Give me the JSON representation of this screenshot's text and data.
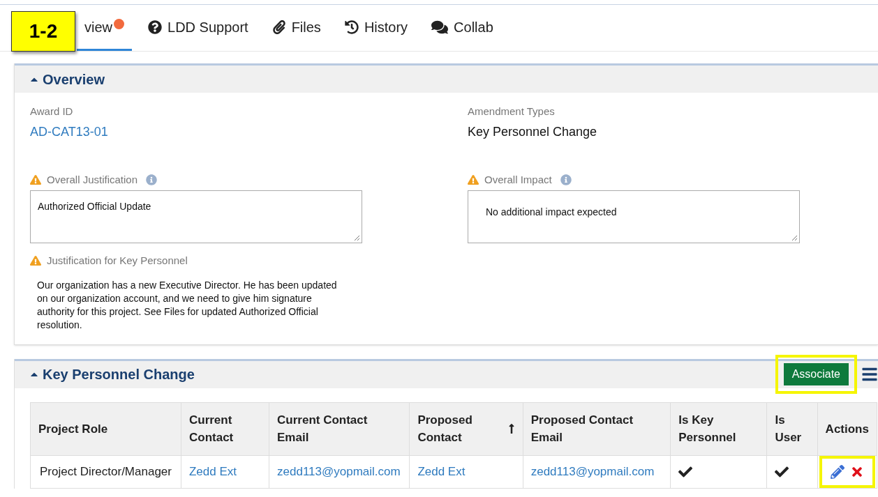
{
  "callout": {
    "label": "1-2"
  },
  "tabs": [
    {
      "label": "view",
      "kind": "plain",
      "selected": true,
      "alert": true
    },
    {
      "label": "LDD Support",
      "kind": "help",
      "selected": false,
      "alert": false
    },
    {
      "label": "Files",
      "kind": "attachments",
      "selected": false,
      "alert": false
    },
    {
      "label": "History",
      "kind": "history",
      "selected": false,
      "alert": false
    },
    {
      "label": "Collab",
      "kind": "chat",
      "selected": false,
      "alert": false
    }
  ],
  "overview": {
    "title": "Overview",
    "expanded": true,
    "award_id": {
      "label": "Award ID",
      "value": "AD-CAT13-01"
    },
    "amendment_types": {
      "label": "Amendment Types",
      "value": "Key Personnel Change"
    },
    "overall_justification": {
      "label": "Overall Justification",
      "value": "Authorized Official Update"
    },
    "overall_impact": {
      "label": "Overall Impact",
      "value": "No additional impact expected"
    },
    "key_personnel_justification": {
      "label": "Justification for Key Personnel",
      "value": "Our organization has a new Executive Director. He has been updated on our organization account, and we need to give him signature authority for this project. See Files for updated Authorized Official resolution."
    }
  },
  "key_personnel": {
    "title": "Key Personnel Change",
    "expanded": true,
    "associate_button": {
      "label": "Associate",
      "highlighted": true
    },
    "table": {
      "columns": [
        {
          "label": "Project Role",
          "sorted": false
        },
        {
          "label": "Current Contact",
          "sorted": false
        },
        {
          "label": "Current Contact Email",
          "sorted": false
        },
        {
          "label": "Proposed Contact",
          "sorted": true
        },
        {
          "label": "Proposed Contact Email",
          "sorted": false
        },
        {
          "label": "Is Key Personnel",
          "sorted": false
        },
        {
          "label": "Is User",
          "sorted": false
        },
        {
          "label": "Actions",
          "sorted": false
        }
      ],
      "rows": [
        {
          "project_role": "Project Director/Manager",
          "current_contact": "Zedd Ext",
          "current_email": "zedd113@yopmail.com",
          "proposed_contact": "Zedd Ext",
          "proposed_email": "zedd113@yopmail.com",
          "is_key_personnel": true,
          "is_user": true,
          "actions_highlighted": true
        }
      ]
    }
  }
}
